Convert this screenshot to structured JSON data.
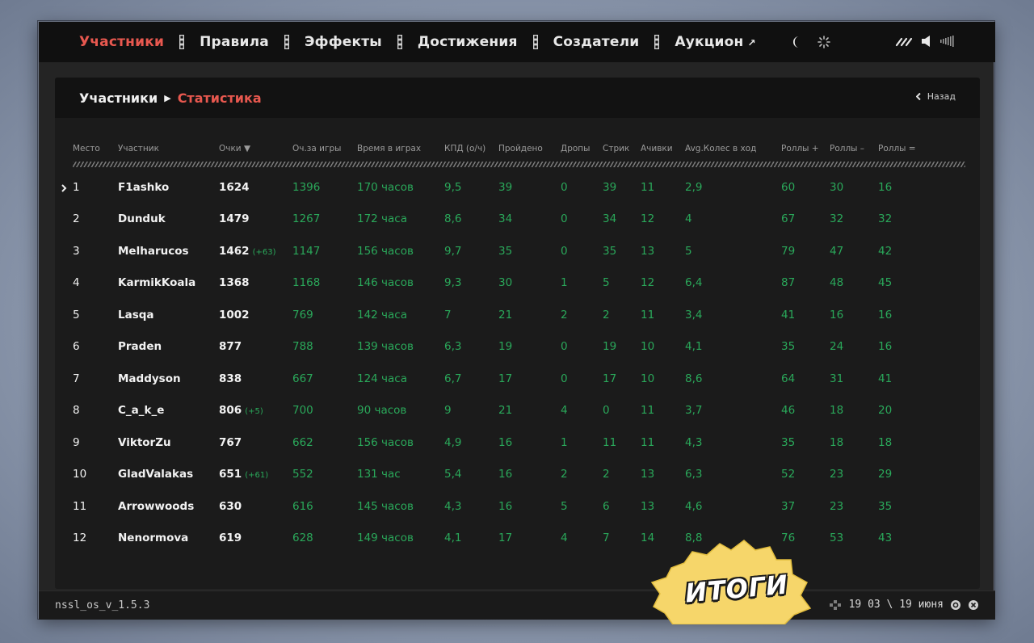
{
  "nav": {
    "items": [
      {
        "label": "Участники",
        "active": true
      },
      {
        "label": "Правила",
        "active": false
      },
      {
        "label": "Эффекты",
        "active": false
      },
      {
        "label": "Достижения",
        "active": false
      },
      {
        "label": "Создатели",
        "active": false
      },
      {
        "label": "Аукцион",
        "active": false
      }
    ],
    "icons": [
      "moon-icon",
      "sun-icon",
      "wave-icon",
      "volume-icon",
      "volume-bars-icon"
    ]
  },
  "breadcrumb": {
    "parent": "Участники",
    "current": "Статистика",
    "back_label": "Назад"
  },
  "table": {
    "columns": [
      "Место",
      "Участник",
      "Очки ▼",
      "Оч.за игры",
      "Время в играх",
      "КПД (о/ч)",
      "Пройдено",
      "Дропы",
      "Стрик",
      "Ачивки",
      "Avg.Колес в ход",
      "Роллы +",
      "Роллы –",
      "Роллы ="
    ],
    "rows": [
      {
        "place": "1",
        "name": "F1ashko",
        "score": "1624",
        "delta": "",
        "game_points": "1396",
        "time": "170 часов",
        "kpd": "9,5",
        "passed": "39",
        "drops": "0",
        "streak": "39",
        "achievements": "11",
        "avg_wheels": "2,9",
        "rolls_plus": "60",
        "rolls_minus": "30",
        "rolls_eq": "16"
      },
      {
        "place": "2",
        "name": "Dunduk",
        "score": "1479",
        "delta": "",
        "game_points": "1267",
        "time": "172 часа",
        "kpd": "8,6",
        "passed": "34",
        "drops": "0",
        "streak": "34",
        "achievements": "12",
        "avg_wheels": "4",
        "rolls_plus": "67",
        "rolls_minus": "32",
        "rolls_eq": "32"
      },
      {
        "place": "3",
        "name": "Melharucos",
        "score": "1462",
        "delta": "(+63)",
        "game_points": "1147",
        "time": "156 часов",
        "kpd": "9,7",
        "passed": "35",
        "drops": "0",
        "streak": "35",
        "achievements": "13",
        "avg_wheels": "5",
        "rolls_plus": "79",
        "rolls_minus": "47",
        "rolls_eq": "42"
      },
      {
        "place": "4",
        "name": "KarmikKoala",
        "score": "1368",
        "delta": "",
        "game_points": "1168",
        "time": "146 часов",
        "kpd": "9,3",
        "passed": "30",
        "drops": "1",
        "streak": "5",
        "achievements": "12",
        "avg_wheels": "6,4",
        "rolls_plus": "87",
        "rolls_minus": "48",
        "rolls_eq": "45"
      },
      {
        "place": "5",
        "name": "Lasqa",
        "score": "1002",
        "delta": "",
        "game_points": "769",
        "time": "142 часа",
        "kpd": "7",
        "passed": "21",
        "drops": "2",
        "streak": "2",
        "achievements": "11",
        "avg_wheels": "3,4",
        "rolls_plus": "41",
        "rolls_minus": "16",
        "rolls_eq": "16"
      },
      {
        "place": "6",
        "name": "Praden",
        "score": "877",
        "delta": "",
        "game_points": "788",
        "time": "139 часов",
        "kpd": "6,3",
        "passed": "19",
        "drops": "0",
        "streak": "19",
        "achievements": "10",
        "avg_wheels": "4,1",
        "rolls_plus": "35",
        "rolls_minus": "24",
        "rolls_eq": "16"
      },
      {
        "place": "7",
        "name": "Maddyson",
        "score": "838",
        "delta": "",
        "game_points": "667",
        "time": "124 часа",
        "kpd": "6,7",
        "passed": "17",
        "drops": "0",
        "streak": "17",
        "achievements": "10",
        "avg_wheels": "8,6",
        "rolls_plus": "64",
        "rolls_minus": "31",
        "rolls_eq": "41"
      },
      {
        "place": "8",
        "name": "C_a_k_e",
        "score": "806",
        "delta": "(+5)",
        "game_points": "700",
        "time": "90 часов",
        "kpd": "9",
        "passed": "21",
        "drops": "4",
        "streak": "0",
        "achievements": "11",
        "avg_wheels": "3,7",
        "rolls_plus": "46",
        "rolls_minus": "18",
        "rolls_eq": "20"
      },
      {
        "place": "9",
        "name": "ViktorZu",
        "score": "767",
        "delta": "",
        "game_points": "662",
        "time": "156 часов",
        "kpd": "4,9",
        "passed": "16",
        "drops": "1",
        "streak": "11",
        "achievements": "11",
        "avg_wheels": "4,3",
        "rolls_plus": "35",
        "rolls_minus": "18",
        "rolls_eq": "18"
      },
      {
        "place": "10",
        "name": "GladValakas",
        "score": "651",
        "delta": "(+61)",
        "game_points": "552",
        "time": "131 час",
        "kpd": "5,4",
        "passed": "16",
        "drops": "2",
        "streak": "2",
        "achievements": "13",
        "avg_wheels": "6,3",
        "rolls_plus": "52",
        "rolls_minus": "23",
        "rolls_eq": "29"
      },
      {
        "place": "11",
        "name": "Arrowwoods",
        "score": "630",
        "delta": "",
        "game_points": "616",
        "time": "145 часов",
        "kpd": "4,3",
        "passed": "16",
        "drops": "5",
        "streak": "6",
        "achievements": "13",
        "avg_wheels": "4,6",
        "rolls_plus": "37",
        "rolls_minus": "23",
        "rolls_eq": "35"
      },
      {
        "place": "12",
        "name": "Nenormova",
        "score": "619",
        "delta": "",
        "game_points": "628",
        "time": "149 часов",
        "kpd": "4,1",
        "passed": "17",
        "drops": "4",
        "streak": "7",
        "achievements": "14",
        "avg_wheels": "8,8",
        "rolls_plus": "76",
        "rolls_minus": "53",
        "rolls_eq": "43"
      }
    ]
  },
  "footer": {
    "version": "nssl_os_v_1.5.3",
    "date": "19 03 \\ 19 июня"
  },
  "badge": {
    "label": "ИТОГИ"
  },
  "colors": {
    "accent": "#e8584f",
    "green": "#2aa85a",
    "badge_yellow": "#f6d66a"
  }
}
